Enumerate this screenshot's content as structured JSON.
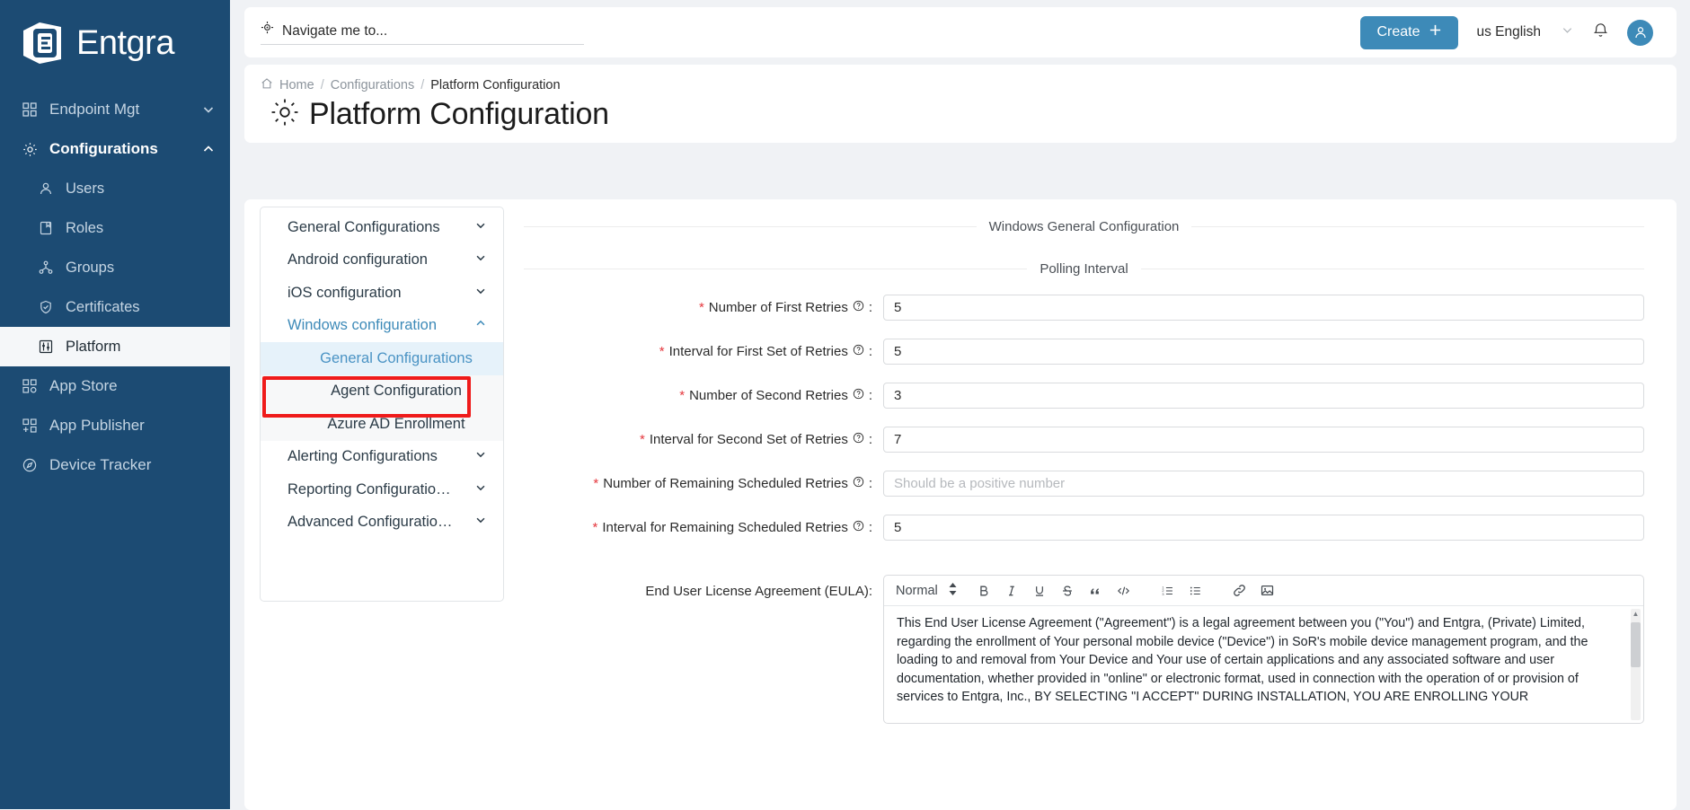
{
  "brand": {
    "name": "Entgra"
  },
  "sidebar": {
    "items": [
      {
        "label": "Endpoint Mgt",
        "icon": "grid-icon",
        "chevron": "chevron-down-icon",
        "state": "collapsed",
        "level": "top"
      },
      {
        "label": "Configurations",
        "icon": "gear-icon",
        "chevron": "chevron-up-icon",
        "state": "expanded",
        "level": "top"
      },
      {
        "label": "Users",
        "icon": "user-icon",
        "state": "normal",
        "level": "sub"
      },
      {
        "label": "Roles",
        "icon": "book-icon",
        "state": "normal",
        "level": "sub"
      },
      {
        "label": "Groups",
        "icon": "group-icon",
        "state": "normal",
        "level": "sub"
      },
      {
        "label": "Certificates",
        "icon": "shield-check-icon",
        "state": "normal",
        "level": "sub"
      },
      {
        "label": "Platform",
        "icon": "sliders-icon",
        "state": "active",
        "level": "sub"
      },
      {
        "label": "App Store",
        "icon": "apps-icon",
        "state": "normal",
        "level": "top"
      },
      {
        "label": "App Publisher",
        "icon": "app-add-icon",
        "state": "normal",
        "level": "top"
      },
      {
        "label": "Device Tracker",
        "icon": "compass-icon",
        "state": "normal",
        "level": "top"
      }
    ]
  },
  "topbar": {
    "search_placeholder": "Navigate me to...",
    "search_value": "",
    "create_label": "Create",
    "language": "us English"
  },
  "pagehead": {
    "breadcrumb": [
      "Home",
      "Configurations",
      "Platform Configuration"
    ],
    "separator": "/",
    "title": "Platform Configuration"
  },
  "config_menu": {
    "groups": [
      {
        "label": "General Configurations",
        "expanded": false
      },
      {
        "label": "Android configuration",
        "expanded": false
      },
      {
        "label": "iOS configuration",
        "expanded": false
      },
      {
        "label": "Windows configuration",
        "expanded": true,
        "children": [
          {
            "label": "General Configurations",
            "selected": true
          },
          {
            "label": "Agent Configuration",
            "selected": false
          },
          {
            "label": "Azure AD Enrollment",
            "selected": false
          }
        ]
      },
      {
        "label": "Alerting Configurations",
        "expanded": false
      },
      {
        "label": "Reporting Configuratio…",
        "expanded": false
      },
      {
        "label": "Advanced Configuratio…",
        "expanded": false
      }
    ]
  },
  "form": {
    "section_title": "Windows General Configuration",
    "subsection_title": "Polling Interval",
    "fields": [
      {
        "label": "Number of First Retries",
        "required": true,
        "value": "5",
        "placeholder": ""
      },
      {
        "label": "Interval for First Set of Retries",
        "required": true,
        "value": "5",
        "placeholder": ""
      },
      {
        "label": "Number of Second Retries",
        "required": true,
        "value": "3",
        "placeholder": ""
      },
      {
        "label": "Interval for Second Set of Retries",
        "required": true,
        "value": "7",
        "placeholder": ""
      },
      {
        "label": "Number of Remaining Scheduled Retries",
        "required": true,
        "value": "",
        "placeholder": "Should be a positive number"
      },
      {
        "label": "Interval for Remaining Scheduled Retries",
        "required": true,
        "value": "5",
        "placeholder": ""
      }
    ],
    "eula": {
      "label": "End User License Agreement (EULA):",
      "toolbar": {
        "format": "Normal",
        "buttons": [
          "bold-icon",
          "italic-icon",
          "underline-icon",
          "strikethrough-icon",
          "blockquote-icon",
          "code-icon",
          "ordered-list-icon",
          "bullet-list-icon",
          "link-icon",
          "image-icon"
        ]
      },
      "body": "This End User License Agreement (\"Agreement\") is a legal agreement between you (\"You\") and Entgra, (Private) Limited, regarding the enrollment of Your personal mobile device (\"Device\") in SoR's mobile device management program, and the loading to and removal from Your Device and Your use of certain applications and any associated software and user documentation, whether provided in \"online\" or electronic format, used in connection with the operation of or provision of services to Entgra, Inc., BY SELECTING \"I ACCEPT\" DURING INSTALLATION, YOU ARE ENROLLING YOUR"
    }
  },
  "colors": {
    "sidebar_bg": "#1c4b73",
    "accent": "#3d8ab8",
    "highlight_box": "#ef1b1b",
    "selected_submenu_bg": "#e6f2fa",
    "required_star": "#e5393f"
  },
  "annotation": {
    "target": "General Configurations",
    "box_color": "#ef1b1b"
  }
}
